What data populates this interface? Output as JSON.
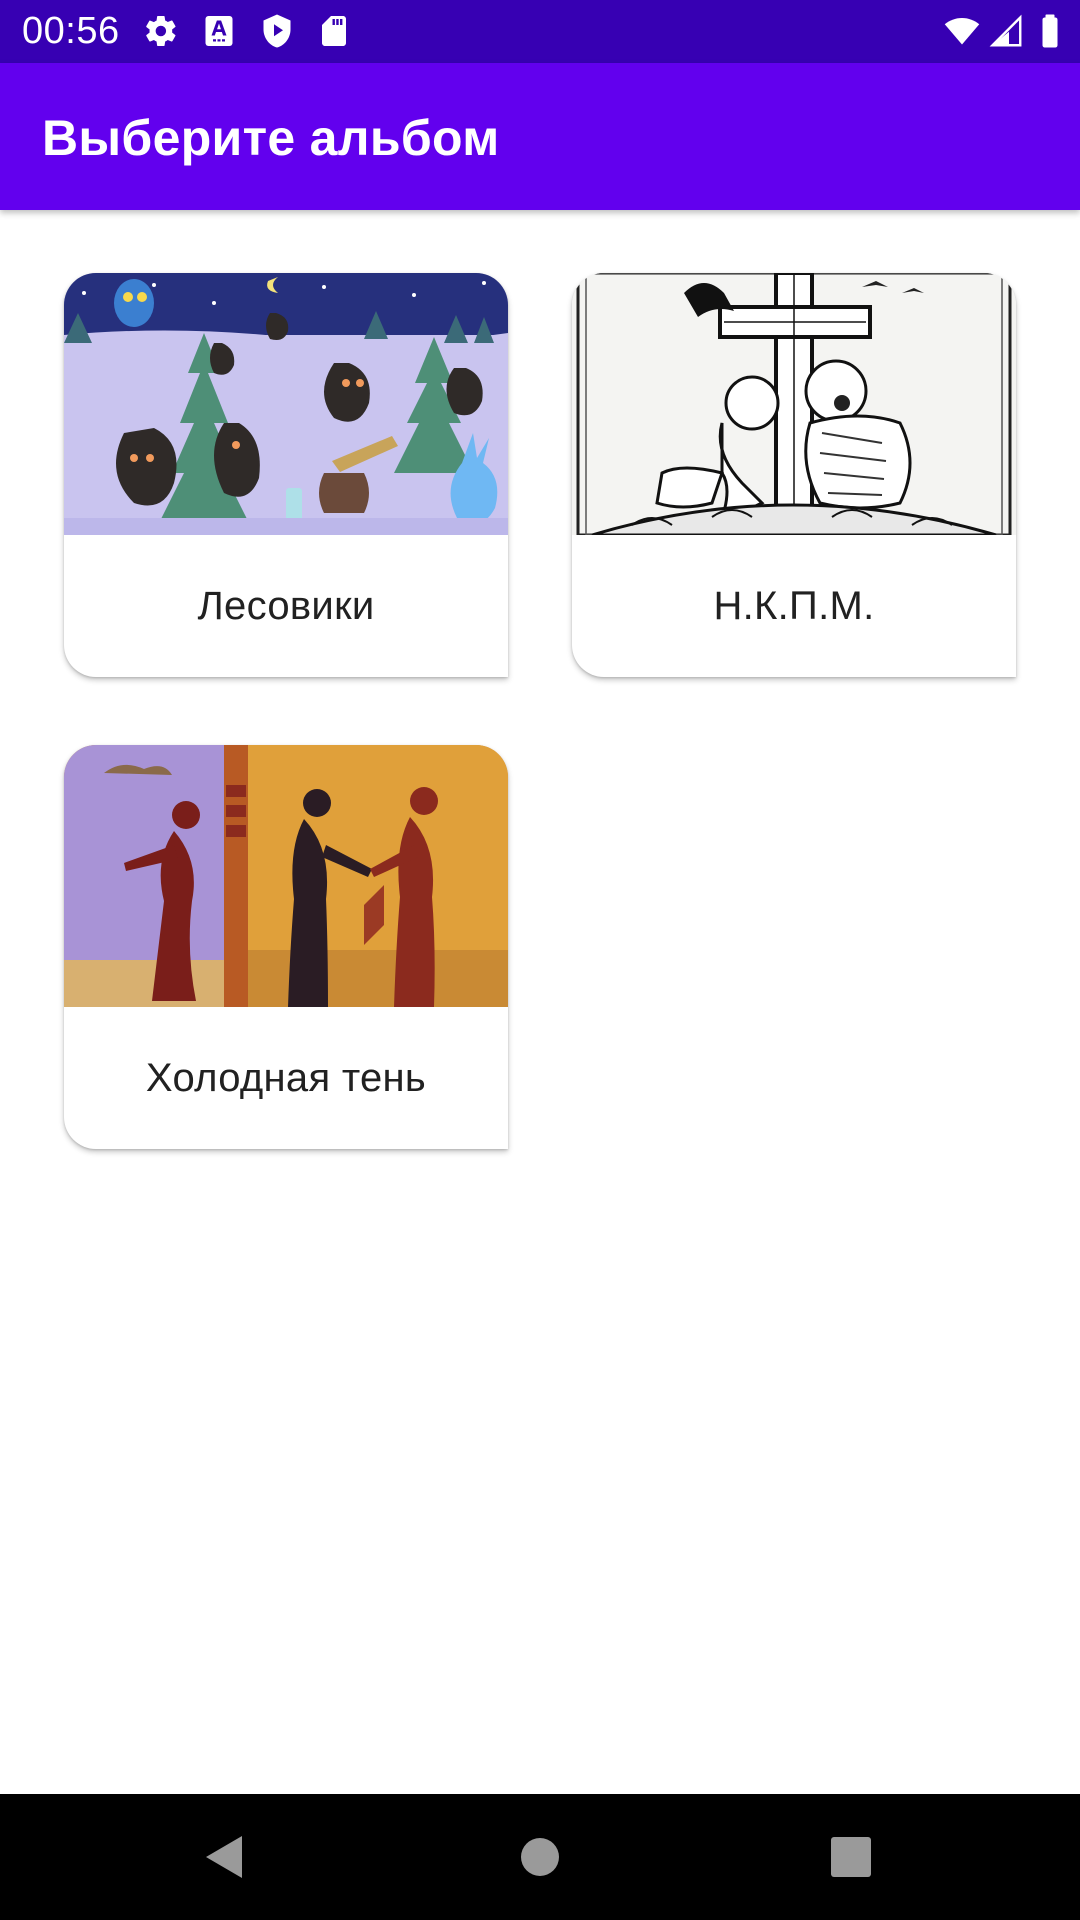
{
  "status_bar": {
    "time": "00:56",
    "left_icons": [
      "gear-icon",
      "font-a-icon",
      "shield-play-icon",
      "sd-card-icon"
    ],
    "right_icons": [
      "wifi-icon",
      "cellular-signal-icon",
      "battery-icon"
    ],
    "background": "#3700b3"
  },
  "app_bar": {
    "title": "Выберите альбом",
    "background": "#6200ee"
  },
  "albums": [
    {
      "title": "Лесовики"
    },
    {
      "title": "Н.К.П.М."
    },
    {
      "title": "Холодная тень"
    }
  ],
  "navigation": {
    "buttons": [
      "back-icon",
      "home-icon",
      "recents-icon"
    ]
  }
}
